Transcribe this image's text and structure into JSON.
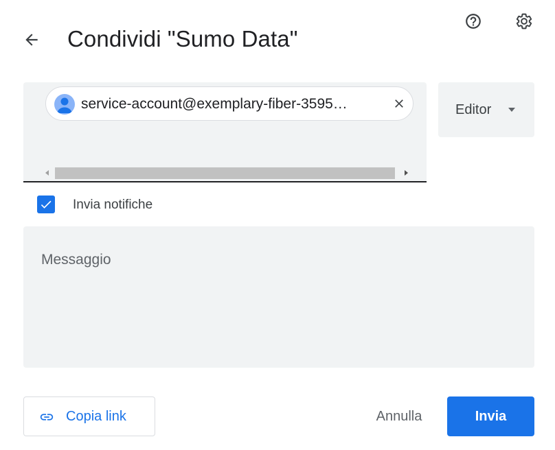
{
  "header": {
    "title": "Condividi \"Sumo Data\"",
    "back_icon": "arrow-back-icon",
    "help_icon": "help-circle-icon",
    "settings_icon": "gear-icon"
  },
  "recipients": {
    "chips": [
      {
        "email": "service-account@exemplary-fiber-3595…",
        "avatar_icon": "person-avatar-icon",
        "remove_icon": "close-icon"
      }
    ]
  },
  "role": {
    "selected": "Editor",
    "caret_icon": "caret-down-icon"
  },
  "notify": {
    "label": "Invia notifiche",
    "checked": true
  },
  "message": {
    "placeholder": "Messaggio"
  },
  "footer": {
    "copy_link_label": "Copia link",
    "copy_link_icon": "link-icon",
    "cancel_label": "Annulla",
    "send_label": "Invia"
  },
  "colors": {
    "accent": "#1a73e8",
    "field_bg": "#f1f3f4",
    "avatar": "#8ab4f8"
  }
}
